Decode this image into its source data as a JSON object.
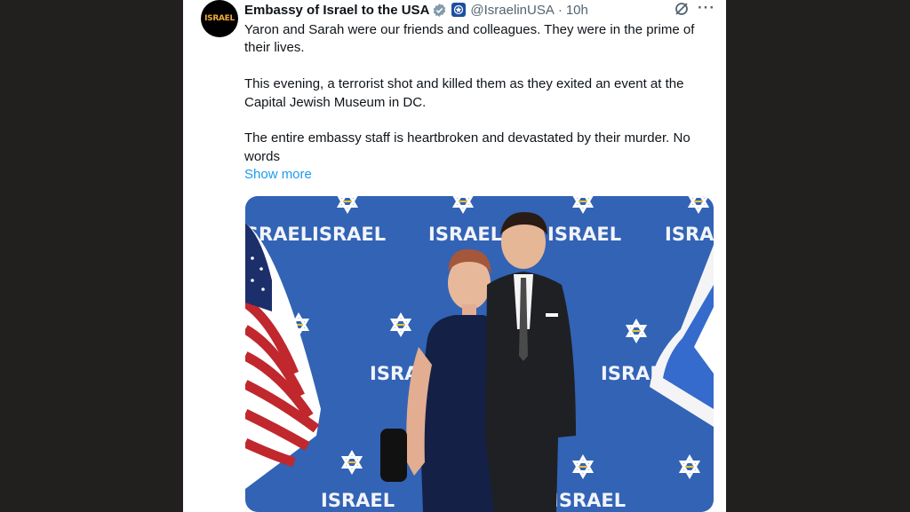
{
  "tweet": {
    "author_name": "Embassy of Israel to the USA",
    "handle": "@IsraelinUSA",
    "separator": "·",
    "time": "10h",
    "avatar_text": "ISRAEL",
    "paragraphs": [
      "Yaron and Sarah were our friends and colleagues. They were in the prime of their lives.",
      "This evening, a terrorist shot and killed them as they exited an event at the Capital Jewish Museum in DC.",
      "The entire embassy staff is heartbroken and devastated by their murder. No words"
    ],
    "show_more": "Show more",
    "photo": {
      "backdrop_word": "ISRAEL"
    }
  },
  "icons": {
    "verified": "verified-badge-icon",
    "org": "government-org-icon",
    "grok": "grok-icon",
    "more": "more-icon"
  },
  "colors": {
    "link": "#1d9bf0",
    "backdrop": "#2f5fb0",
    "verified": "#829aab"
  }
}
